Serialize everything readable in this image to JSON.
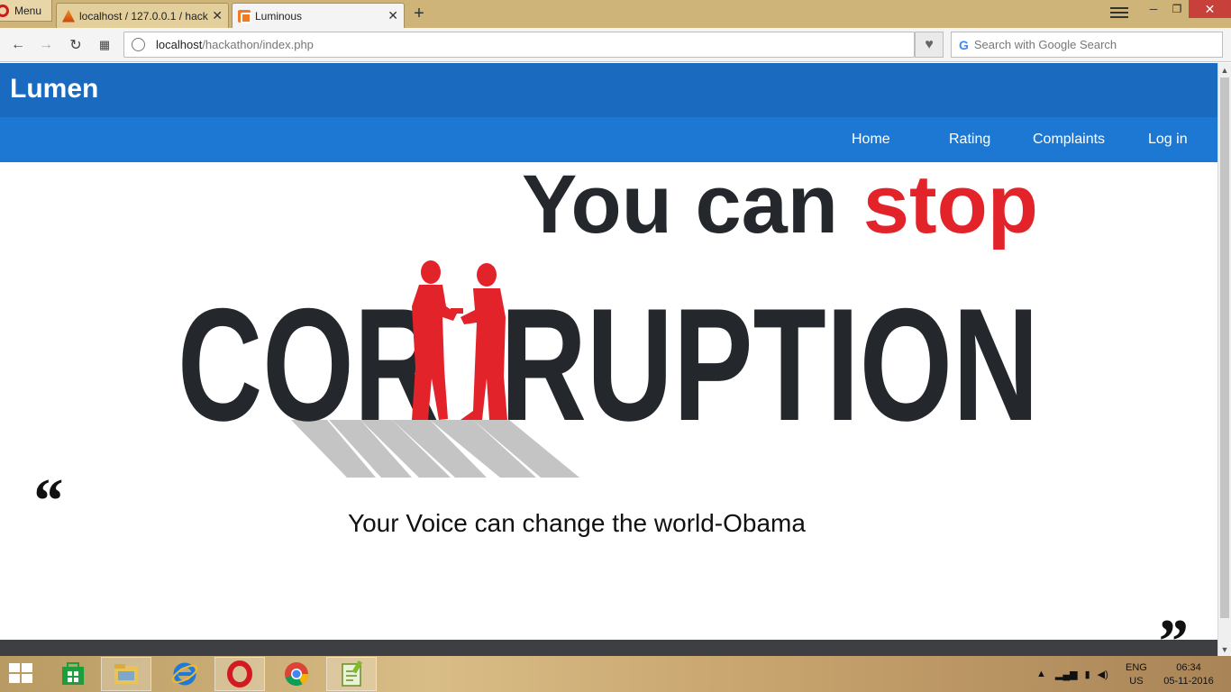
{
  "browser": {
    "menu_label": "Menu",
    "tabs": [
      {
        "title": "localhost / 127.0.0.1 / hackathon",
        "icon": "phpmyadmin-icon",
        "active": false
      },
      {
        "title": "Luminous",
        "icon": "xampp-icon",
        "active": true
      }
    ],
    "url_host": "localhost",
    "url_path": "/hackathon/index.php",
    "search_placeholder": "Search with Google Search"
  },
  "site": {
    "brand": "Lumen",
    "nav": [
      {
        "label": "Home"
      },
      {
        "label": "Rating"
      },
      {
        "label": "Complaints"
      },
      {
        "label": "Log in"
      }
    ],
    "hero": {
      "line1_dark": "You can",
      "line1_red": "stop",
      "word_left": "COR",
      "word_right": "RUPTION"
    },
    "quote": {
      "open_mark": "“",
      "text": "Your Voice can change the world-Obama",
      "close_mark": "”"
    },
    "colors": {
      "brand_bar": "#1a6bbf",
      "nav_bar": "#1d78d4",
      "hero_dark": "#24282c",
      "hero_red": "#e3232a"
    }
  },
  "taskbar": {
    "apps": [
      "store-icon",
      "file-explorer-icon",
      "internet-explorer-icon",
      "opera-icon",
      "chrome-icon",
      "notepad-plus-icon"
    ],
    "language": "ENG",
    "region": "US",
    "time": "06:34",
    "date": "05-11-2016"
  }
}
